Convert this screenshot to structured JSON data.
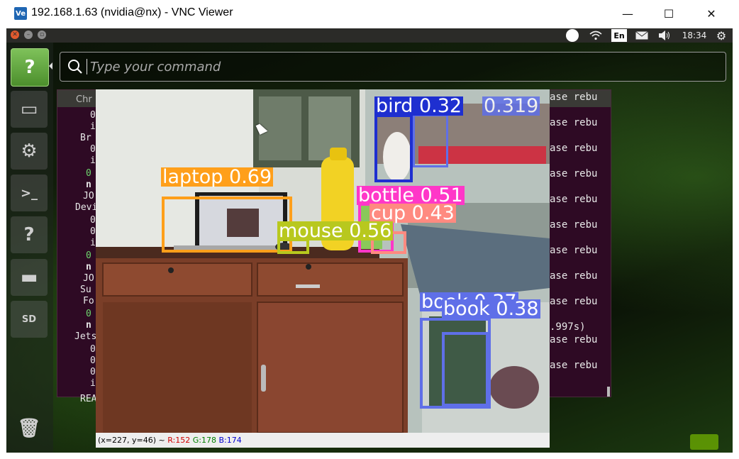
{
  "window": {
    "logo_text": "Ve",
    "title": "192.168.1.63 (nvidia@nx) - VNC Viewer",
    "minimize": "—",
    "maximize": "☐",
    "close": "✕"
  },
  "topbar": {
    "language": "En",
    "time": "18:34"
  },
  "dash": {
    "search_placeholder": "Type your command"
  },
  "launcher": {
    "items": [
      {
        "label": "?",
        "icon": "help-icon"
      },
      {
        "label": "▭",
        "icon": "files-icon"
      },
      {
        "label": "⚙",
        "icon": "settings-icon"
      },
      {
        "label": ">_",
        "icon": "terminal-icon"
      },
      {
        "label": "?",
        "icon": "help-icon"
      },
      {
        "label": "▬",
        "icon": "drive-icon"
      },
      {
        "label": "SD",
        "icon": "sd-card-icon"
      },
      {
        "label": "🗑",
        "icon": "trash-icon"
      }
    ]
  },
  "terminal": {
    "left_lines": [
      "Chr",
      "0",
      "i",
      "Br",
      "0",
      "i",
      "0",
      "n",
      "JO",
      "Devi",
      "0",
      "0",
      "i",
      "0",
      "n",
      "JO",
      "Su",
      "Fo",
      "0",
      "n",
      "Jets",
      "0",
      "0",
      "0",
      "i",
      "REA"
    ],
    "right_lines": [
      "ase rebu",
      "ase rebu",
      "ase rebu",
      "ase rebu",
      "ase rebu",
      "ase rebu",
      "ase rebu",
      "ase rebu",
      "ase rebu",
      ".997s)",
      "ase rebu",
      "ase rebu"
    ]
  },
  "detection": {
    "labels": [
      {
        "text": "laptop 0.69",
        "color": "#ff9f1a"
      },
      {
        "text": "bird 0.32",
        "color": "#1e2fd0"
      },
      {
        "text": "0.319",
        "color": "#5f6fe8"
      },
      {
        "text": "bottle 0.51",
        "color": "#ff37c8"
      },
      {
        "text": "cup 0.43",
        "color": "#ff8a80"
      },
      {
        "text": "mouse 0.56",
        "color": "#b8c81e"
      },
      {
        "text": "book 0.37",
        "color": "#5f6fe8"
      },
      {
        "text": "book 0.38",
        "color": "#5f6fe8"
      }
    ],
    "status": {
      "coords": "(x=227, y=46) ~",
      "r": "R:152",
      "g": "G:178",
      "b": "B:174"
    }
  }
}
